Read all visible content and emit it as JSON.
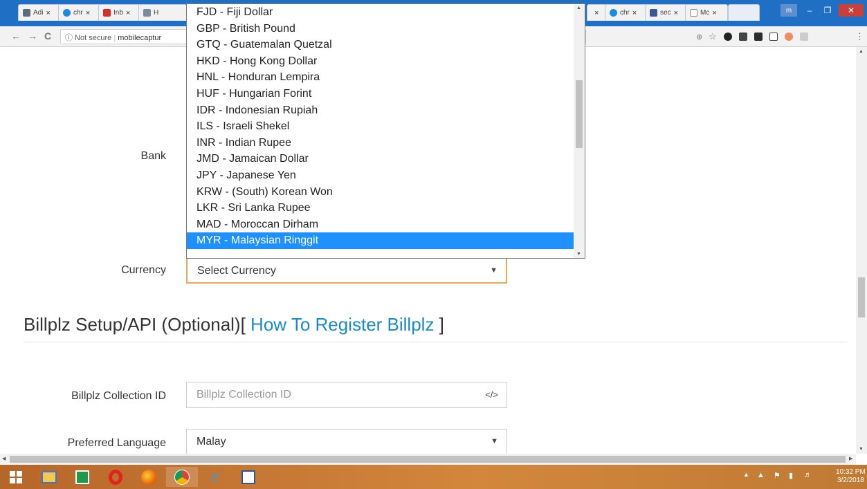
{
  "browser": {
    "tabs": [
      {
        "label": "Adi",
        "color": "#5c6b7a"
      },
      {
        "label": "chr",
        "color": "#1e88e5"
      },
      {
        "label": "Inb",
        "color": "#d93025"
      },
      {
        "label": "H",
        "color": "#7b8b9b"
      },
      {
        "label": "chr",
        "color": "#1e88e5"
      },
      {
        "label": "sec",
        "color": "#3b5998"
      },
      {
        "label": "Mc",
        "color": "#8a8a8a"
      }
    ],
    "tab_close": "×",
    "window_user": "m",
    "security_label": "ⓘ Not secure",
    "url": "mobilecaptur"
  },
  "form": {
    "bank_label": "Bank",
    "currency_label": "Currency",
    "currency_value": "Select Currency",
    "currency_options": [
      "FJD - Fiji Dollar",
      "GBP - British Pound",
      "GTQ - Guatemalan Quetzal",
      "HKD - Hong Kong Dollar",
      "HNL - Honduran Lempira",
      "HUF - Hungarian Forint",
      "IDR - Indonesian Rupiah",
      "ILS - Israeli Shekel",
      "INR - Indian Rupee",
      "JMD - Jamaican Dollar",
      "JPY - Japanese Yen",
      "KRW - (South) Korean Won",
      "LKR - Sri Lanka Rupee",
      "MAD - Moroccan Dirham",
      "MYR - Malaysian Ringgit"
    ],
    "highlighted_option": "MYR - Malaysian Ringgit",
    "section_title": "Billplz Setup/API (Optional)[ ",
    "section_link": "How To Register Billplz",
    "section_close": " ]",
    "collection_label": "Billplz Collection ID",
    "collection_placeholder": "Billplz Collection ID",
    "collection_icon": "</>",
    "language_label": "Preferred Language",
    "language_value": "Malay"
  },
  "taskbar": {
    "time": "10:32 PM",
    "date": "3/2/2018"
  }
}
